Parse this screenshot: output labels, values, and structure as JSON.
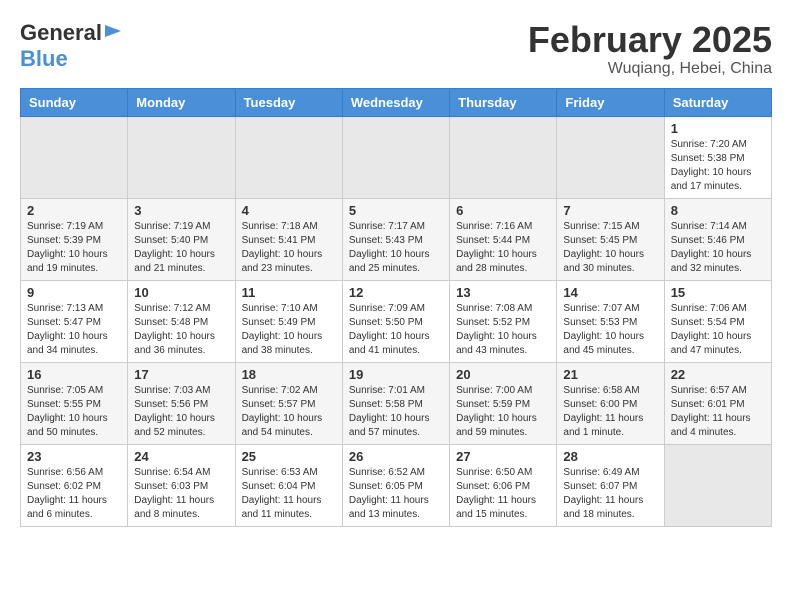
{
  "header": {
    "logo_general": "General",
    "logo_blue": "Blue",
    "month_title": "February 2025",
    "subtitle": "Wuqiang, Hebei, China"
  },
  "weekdays": [
    "Sunday",
    "Monday",
    "Tuesday",
    "Wednesday",
    "Thursday",
    "Friday",
    "Saturday"
  ],
  "weeks": [
    [
      {
        "day": "",
        "info": ""
      },
      {
        "day": "",
        "info": ""
      },
      {
        "day": "",
        "info": ""
      },
      {
        "day": "",
        "info": ""
      },
      {
        "day": "",
        "info": ""
      },
      {
        "day": "",
        "info": ""
      },
      {
        "day": "1",
        "info": "Sunrise: 7:20 AM\nSunset: 5:38 PM\nDaylight: 10 hours\nand 17 minutes."
      }
    ],
    [
      {
        "day": "2",
        "info": "Sunrise: 7:19 AM\nSunset: 5:39 PM\nDaylight: 10 hours\nand 19 minutes."
      },
      {
        "day": "3",
        "info": "Sunrise: 7:19 AM\nSunset: 5:40 PM\nDaylight: 10 hours\nand 21 minutes."
      },
      {
        "day": "4",
        "info": "Sunrise: 7:18 AM\nSunset: 5:41 PM\nDaylight: 10 hours\nand 23 minutes."
      },
      {
        "day": "5",
        "info": "Sunrise: 7:17 AM\nSunset: 5:43 PM\nDaylight: 10 hours\nand 25 minutes."
      },
      {
        "day": "6",
        "info": "Sunrise: 7:16 AM\nSunset: 5:44 PM\nDaylight: 10 hours\nand 28 minutes."
      },
      {
        "day": "7",
        "info": "Sunrise: 7:15 AM\nSunset: 5:45 PM\nDaylight: 10 hours\nand 30 minutes."
      },
      {
        "day": "8",
        "info": "Sunrise: 7:14 AM\nSunset: 5:46 PM\nDaylight: 10 hours\nand 32 minutes."
      }
    ],
    [
      {
        "day": "9",
        "info": "Sunrise: 7:13 AM\nSunset: 5:47 PM\nDaylight: 10 hours\nand 34 minutes."
      },
      {
        "day": "10",
        "info": "Sunrise: 7:12 AM\nSunset: 5:48 PM\nDaylight: 10 hours\nand 36 minutes."
      },
      {
        "day": "11",
        "info": "Sunrise: 7:10 AM\nSunset: 5:49 PM\nDaylight: 10 hours\nand 38 minutes."
      },
      {
        "day": "12",
        "info": "Sunrise: 7:09 AM\nSunset: 5:50 PM\nDaylight: 10 hours\nand 41 minutes."
      },
      {
        "day": "13",
        "info": "Sunrise: 7:08 AM\nSunset: 5:52 PM\nDaylight: 10 hours\nand 43 minutes."
      },
      {
        "day": "14",
        "info": "Sunrise: 7:07 AM\nSunset: 5:53 PM\nDaylight: 10 hours\nand 45 minutes."
      },
      {
        "day": "15",
        "info": "Sunrise: 7:06 AM\nSunset: 5:54 PM\nDaylight: 10 hours\nand 47 minutes."
      }
    ],
    [
      {
        "day": "16",
        "info": "Sunrise: 7:05 AM\nSunset: 5:55 PM\nDaylight: 10 hours\nand 50 minutes."
      },
      {
        "day": "17",
        "info": "Sunrise: 7:03 AM\nSunset: 5:56 PM\nDaylight: 10 hours\nand 52 minutes."
      },
      {
        "day": "18",
        "info": "Sunrise: 7:02 AM\nSunset: 5:57 PM\nDaylight: 10 hours\nand 54 minutes."
      },
      {
        "day": "19",
        "info": "Sunrise: 7:01 AM\nSunset: 5:58 PM\nDaylight: 10 hours\nand 57 minutes."
      },
      {
        "day": "20",
        "info": "Sunrise: 7:00 AM\nSunset: 5:59 PM\nDaylight: 10 hours\nand 59 minutes."
      },
      {
        "day": "21",
        "info": "Sunrise: 6:58 AM\nSunset: 6:00 PM\nDaylight: 11 hours\nand 1 minute."
      },
      {
        "day": "22",
        "info": "Sunrise: 6:57 AM\nSunset: 6:01 PM\nDaylight: 11 hours\nand 4 minutes."
      }
    ],
    [
      {
        "day": "23",
        "info": "Sunrise: 6:56 AM\nSunset: 6:02 PM\nDaylight: 11 hours\nand 6 minutes."
      },
      {
        "day": "24",
        "info": "Sunrise: 6:54 AM\nSunset: 6:03 PM\nDaylight: 11 hours\nand 8 minutes."
      },
      {
        "day": "25",
        "info": "Sunrise: 6:53 AM\nSunset: 6:04 PM\nDaylight: 11 hours\nand 11 minutes."
      },
      {
        "day": "26",
        "info": "Sunrise: 6:52 AM\nSunset: 6:05 PM\nDaylight: 11 hours\nand 13 minutes."
      },
      {
        "day": "27",
        "info": "Sunrise: 6:50 AM\nSunset: 6:06 PM\nDaylight: 11 hours\nand 15 minutes."
      },
      {
        "day": "28",
        "info": "Sunrise: 6:49 AM\nSunset: 6:07 PM\nDaylight: 11 hours\nand 18 minutes."
      },
      {
        "day": "",
        "info": ""
      }
    ]
  ]
}
